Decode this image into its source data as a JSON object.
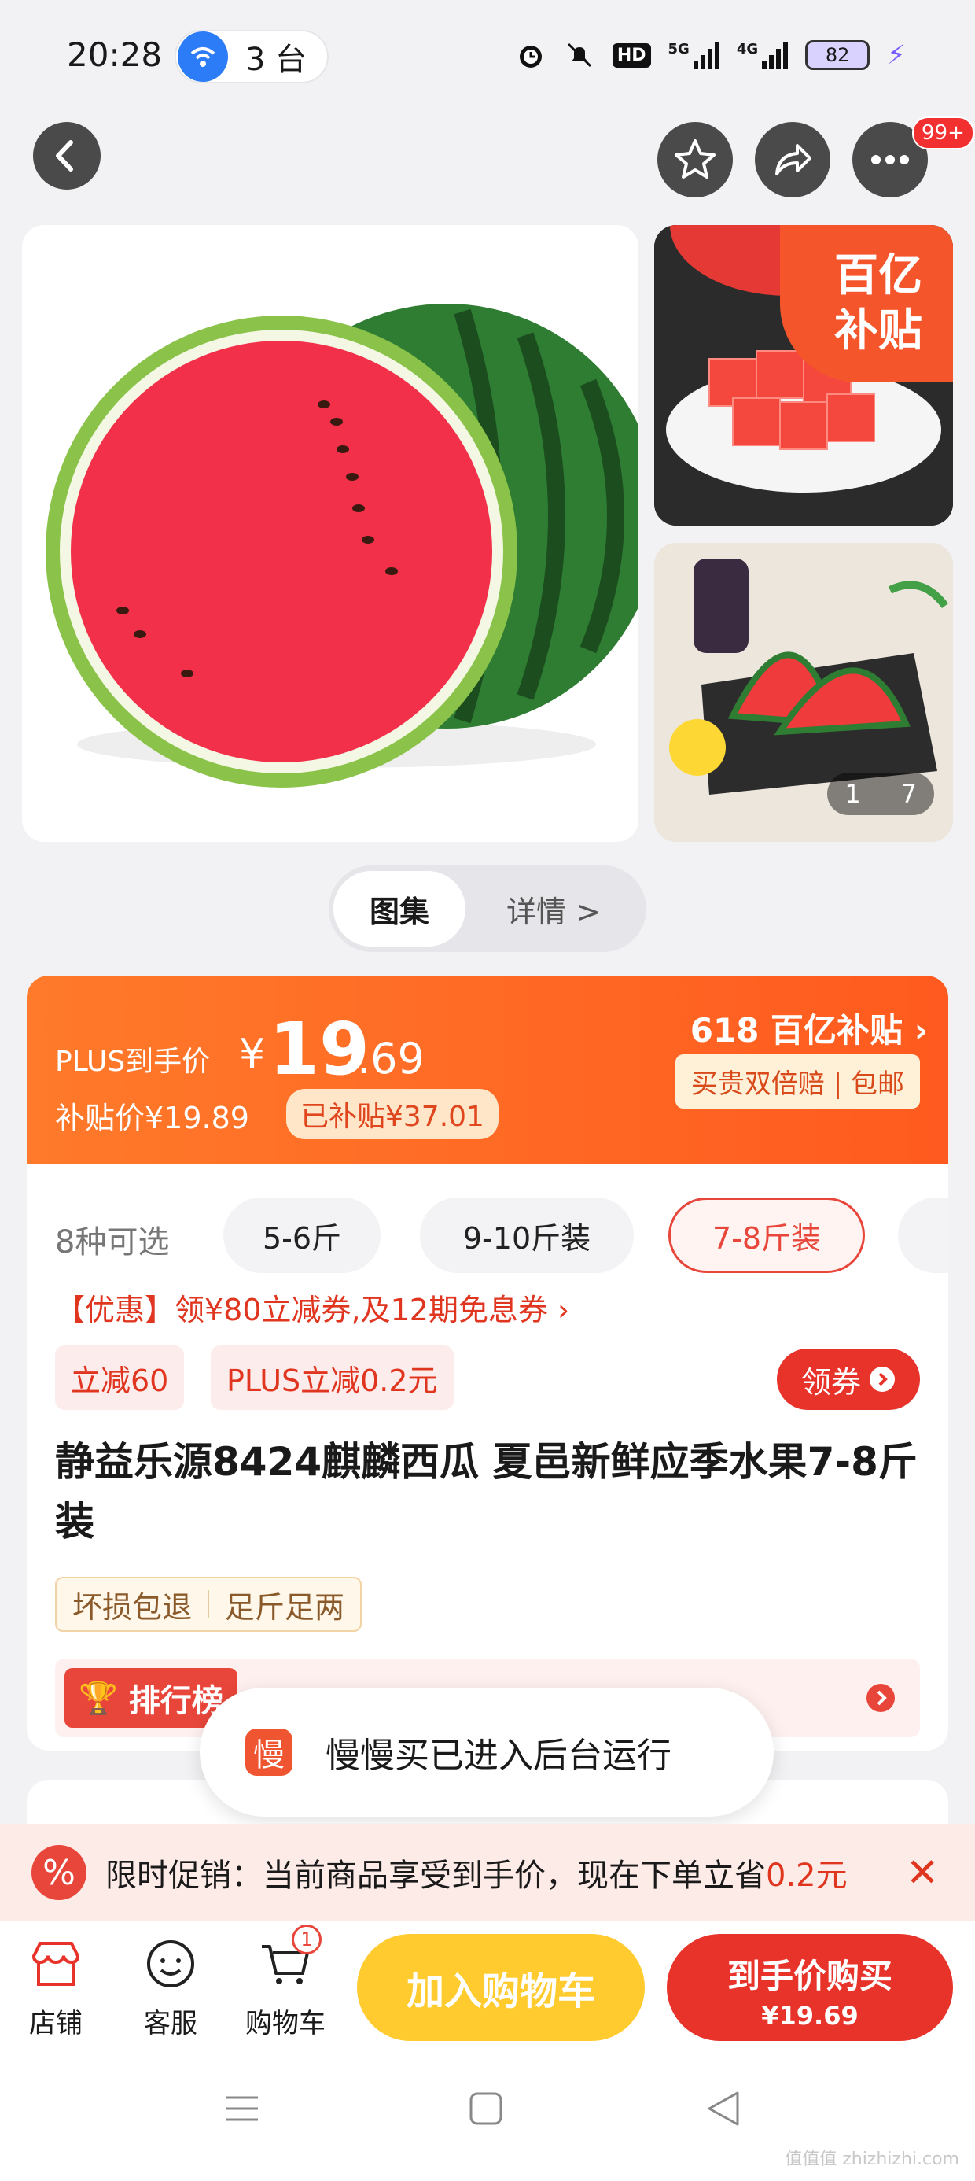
{
  "status_bar": {
    "time": "20:28",
    "hotspot_count": "3 台",
    "battery": "82"
  },
  "gallery": {
    "badge_line1": "百亿",
    "badge_line2": "补贴",
    "counter_current": "1",
    "counter_total": "7"
  },
  "more_badge": "99+",
  "tabs": {
    "gallery": "图集",
    "details": "详情 >"
  },
  "price": {
    "plus_label": "PLUS到手价",
    "currency": "¥",
    "integer": "19",
    "decimal": ".69",
    "subsidy_price": "补贴价¥19.89",
    "subsidized": "已补贴¥37.01",
    "promo_618": "618 百亿补贴",
    "promo_pill": "买贵双倍赔 | 包邮"
  },
  "options": {
    "count_label": "8种可选",
    "chips": [
      "5-6斤",
      "9-10斤装",
      "7-8斤装"
    ]
  },
  "coupon": {
    "line": "【优惠】领¥80立减券,及12期免息券 ›",
    "tag1": "立减60",
    "tag2": "PLUS立减0.2元",
    "get_label": "领券"
  },
  "product": {
    "title": "静益乐源8424麒麟西瓜 夏邑新鲜应季水果7-8斤装"
  },
  "services": [
    "坏损包退",
    "足斤足两"
  ],
  "rank": {
    "tag": "排行榜"
  },
  "toast": {
    "icon_text": "慢",
    "text": "慢慢买已进入后台运行"
  },
  "promo_bar": {
    "text": "限时促销：当前商品享受到手价，现在下单立省",
    "amount": "0.2元"
  },
  "bottom_bar": {
    "store": "店铺",
    "service": "客服",
    "cart": "购物车",
    "cart_badge": "1",
    "add_to_cart": "加入购物车",
    "buy_label": "到手价购买",
    "buy_price": "¥19.69"
  },
  "watermark": "值值值 zhizhizhi.com"
}
